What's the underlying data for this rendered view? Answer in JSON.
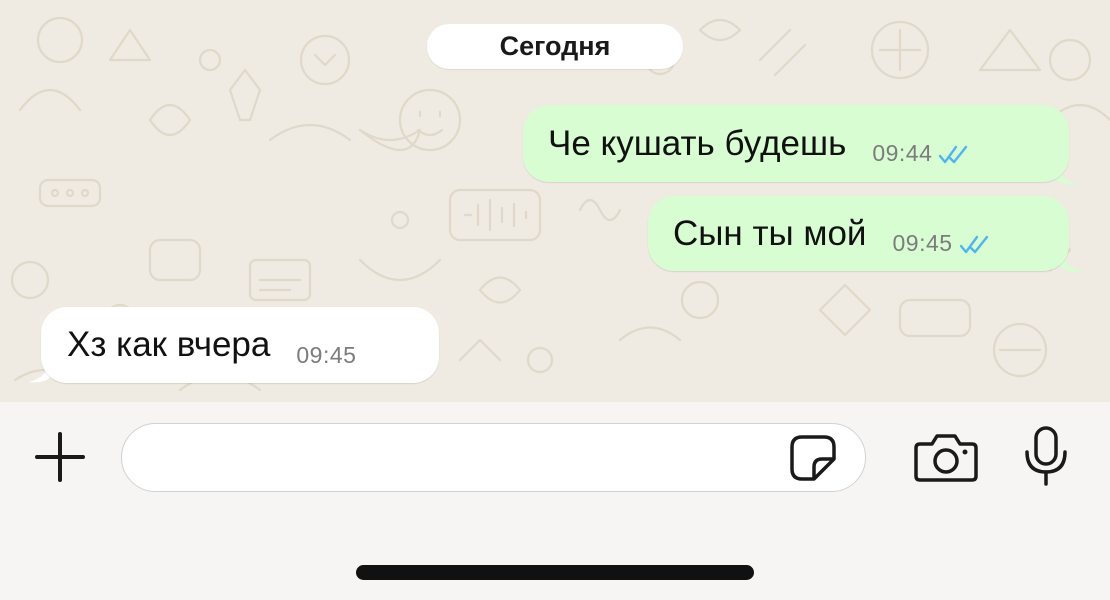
{
  "colors": {
    "chat_background": "#efeae2",
    "outgoing_bubble": "#d9fdd3",
    "incoming_bubble": "#ffffff",
    "read_ticks": "#4fb6ec",
    "timestamp": "#7c7c7c",
    "input_bar": "#f6f5f3"
  },
  "chat": {
    "date_separator": "Сегодня",
    "messages": [
      {
        "direction": "outgoing",
        "text": "Че кушать будешь",
        "time": "09:44",
        "status": "read"
      },
      {
        "direction": "outgoing",
        "text": "Сын ты мой",
        "time": "09:45",
        "status": "read"
      },
      {
        "direction": "incoming",
        "text": "Хз как вчера",
        "time": "09:45"
      }
    ]
  },
  "composer": {
    "attach_icon": "plus-icon",
    "input_value": "",
    "sticker_icon": "sticker-icon",
    "camera_icon": "camera-icon",
    "mic_icon": "microphone-icon"
  }
}
